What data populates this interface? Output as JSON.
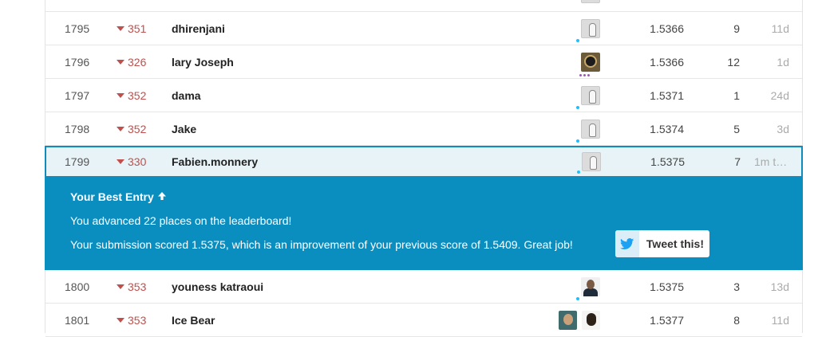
{
  "rows_before": [
    {
      "rank": "1795",
      "change": "351",
      "team": "dhirenjani",
      "avatar": "goose",
      "score": "1.5366",
      "entries": "9",
      "last": "11d"
    },
    {
      "rank": "1796",
      "change": "326",
      "team": "lary Joseph",
      "avatar": "photo",
      "score": "1.5366",
      "entries": "12",
      "last": "1d"
    },
    {
      "rank": "1797",
      "change": "352",
      "team": "dama",
      "avatar": "goose",
      "score": "1.5371",
      "entries": "1",
      "last": "24d"
    },
    {
      "rank": "1798",
      "change": "352",
      "team": "Jake",
      "avatar": "goose",
      "score": "1.5374",
      "entries": "5",
      "last": "3d"
    }
  ],
  "highlight_row": {
    "rank": "1799",
    "change": "330",
    "team": "Fabien.monnery",
    "avatar": "goose",
    "score": "1.5375",
    "entries": "7",
    "last": "1m t…"
  },
  "banner": {
    "heading": "Your Best Entry",
    "heading_icon": "arrow-up-icon",
    "line1": "You advanced 22 places on the leaderboard!",
    "line2": "Your submission scored 1.5375, which is an improvement of your previous score of 1.5409. Great job!",
    "tweet_label": "Tweet this!",
    "tweet_icon": "twitter-bird-icon"
  },
  "rows_after": [
    {
      "rank": "1800",
      "change": "353",
      "team": "youness katraoui",
      "avatar": "photo",
      "score": "1.5375",
      "entries": "3",
      "last": "13d"
    },
    {
      "rank": "1801",
      "change": "353",
      "team": "Ice Bear",
      "avatar": "photo",
      "score": "1.5377",
      "entries": "8",
      "last": "11d"
    }
  ],
  "colors": {
    "banner_bg": "#0a8ec0",
    "highlight_border": "#0f8cbd",
    "highlight_bg": "#e8f3f8",
    "change_down": "#c0504d",
    "novice_tier": "#20beff",
    "twitter_blue": "#1da1f2"
  }
}
